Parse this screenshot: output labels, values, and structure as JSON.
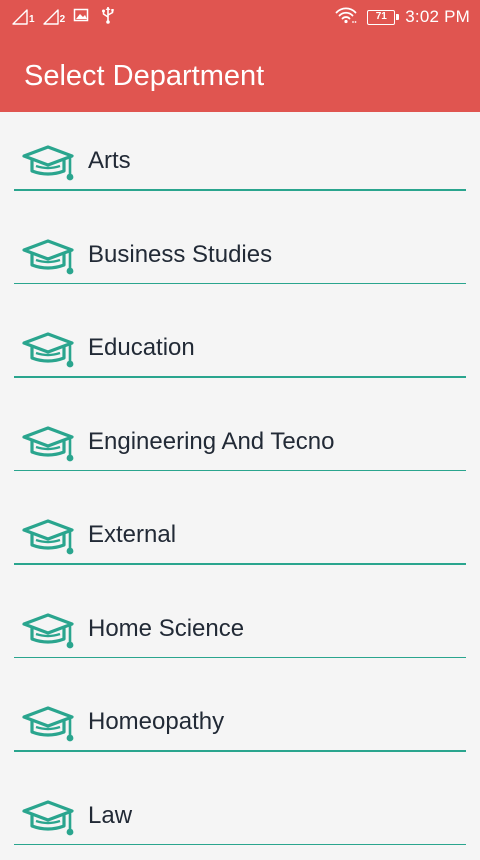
{
  "status_bar": {
    "sim1_label": "1",
    "sim2_label": "2",
    "battery_level": "71",
    "time": "3:02 PM"
  },
  "app_bar": {
    "title": "Select Department",
    "background_color": "#e05550"
  },
  "accent_color": "#2aa58e",
  "departments": [
    {
      "label": "Arts",
      "icon": "graduation-cap-icon"
    },
    {
      "label": "Business Studies",
      "icon": "graduation-cap-icon"
    },
    {
      "label": "Education",
      "icon": "graduation-cap-icon"
    },
    {
      "label": "Engineering And Tecno",
      "icon": "graduation-cap-icon"
    },
    {
      "label": "External",
      "icon": "graduation-cap-icon"
    },
    {
      "label": "Home Science",
      "icon": "graduation-cap-icon"
    },
    {
      "label": "Homeopathy",
      "icon": "graduation-cap-icon"
    },
    {
      "label": "Law",
      "icon": "graduation-cap-icon"
    }
  ]
}
